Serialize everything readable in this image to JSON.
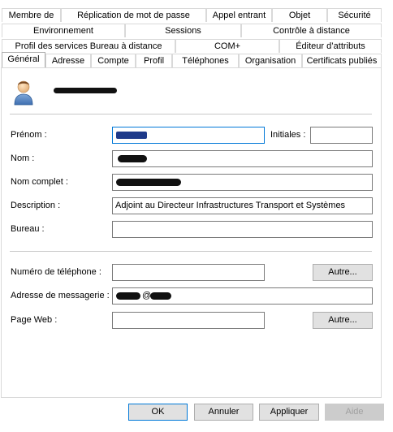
{
  "tabs": {
    "row1": [
      "Membre de",
      "Réplication de mot de passe",
      "Appel entrant",
      "Objet",
      "Sécurité"
    ],
    "row2": [
      "Environnement",
      "Sessions",
      "Contrôle à distance"
    ],
    "row3": [
      "Profil des services Bureau à distance",
      "COM+",
      "Éditeur d’attributs"
    ],
    "row4": [
      "Général",
      "Adresse",
      "Compte",
      "Profil",
      "Téléphones",
      "Organisation",
      "Certificats publiés"
    ],
    "active": "Général"
  },
  "user": {
    "icon": "user-icon",
    "name_redacted": true
  },
  "form": {
    "first_name_label": "Prénom :",
    "initials_label": "Initiales :",
    "initials_value": "",
    "last_name_label": "Nom :",
    "full_name_label": "Nom complet :",
    "description_label": "Description :",
    "description_value": "Adjoint au Directeur Infrastructures Transport et Systèmes",
    "office_label": "Bureau :",
    "office_value": "",
    "phone_label": "Numéro de téléphone :",
    "phone_value": "",
    "email_label": "Adresse de messagerie :",
    "email_visible_part": "@",
    "webpage_label": "Page Web :",
    "webpage_value": "",
    "other_button": "Autre..."
  },
  "buttons": {
    "ok": "OK",
    "cancel": "Annuler",
    "apply": "Appliquer",
    "help": "Aide"
  },
  "colors": {
    "focus_border": "#0078d7",
    "button_face": "#e1e1e1",
    "disabled_button": "#cccccc",
    "disabled_text": "#a0a0a0"
  }
}
